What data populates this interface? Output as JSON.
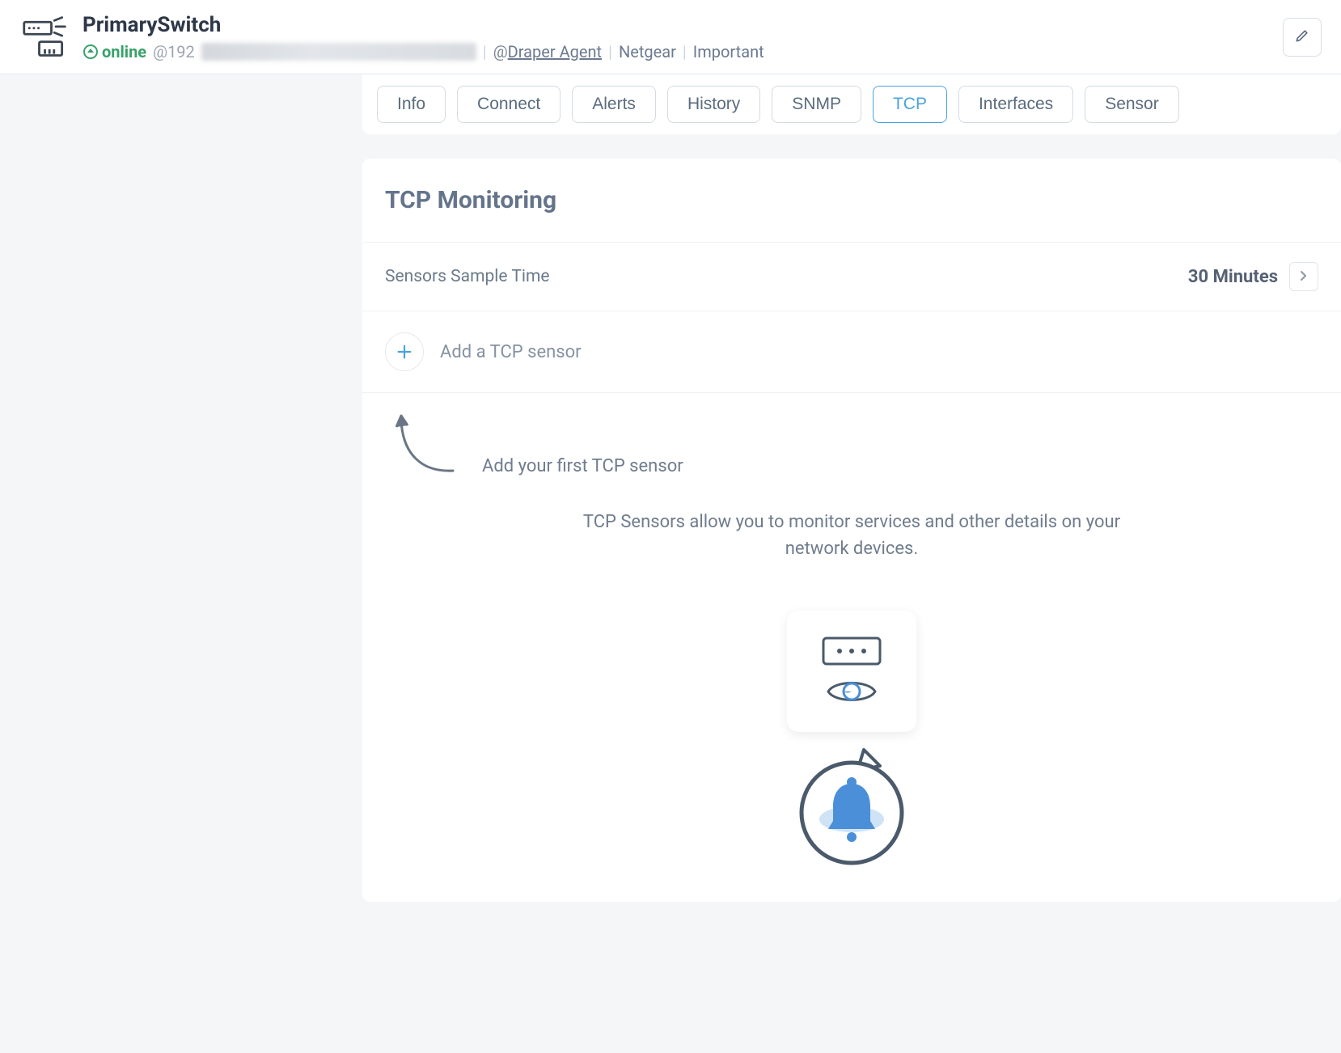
{
  "header": {
    "device_name": "PrimarySwitch",
    "status": "online",
    "ip_prefix": "@192",
    "agent_prefix": "@",
    "agent_name": "Draper Agent",
    "vendor": "Netgear",
    "importance": "Important"
  },
  "tabs": [
    {
      "label": "Info",
      "active": false
    },
    {
      "label": "Connect",
      "active": false
    },
    {
      "label": "Alerts",
      "active": false
    },
    {
      "label": "History",
      "active": false
    },
    {
      "label": "SNMP",
      "active": false
    },
    {
      "label": "TCP",
      "active": true
    },
    {
      "label": "Interfaces",
      "active": false
    },
    {
      "label": "Sensor",
      "active": false
    }
  ],
  "panel": {
    "title": "TCP Monitoring",
    "sample_time_label": "Sensors Sample Time",
    "sample_time_value": "30 Minutes",
    "add_sensor_label": "Add a TCP sensor",
    "hint_text": "Add your first TCP sensor",
    "description": "TCP Sensors allow you to monitor services and other details on your network devices."
  }
}
